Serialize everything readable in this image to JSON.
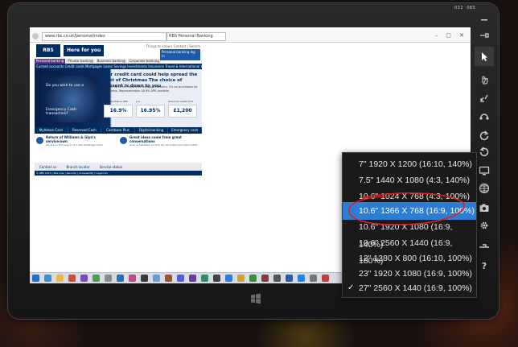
{
  "clock": {
    "left": "032",
    "right": "085"
  },
  "browser": {
    "address": "www.rbs.co.uk/personal/index",
    "tab_title": "RBS Personal Banking",
    "window_controls": "– ▢ ✕"
  },
  "rbs": {
    "logo": "RBS",
    "tagline": "Here for you",
    "top_links": "Things to know | Contact | Search",
    "login": "Personal banking log in",
    "tabs": [
      "Personal banking",
      "Private banking",
      "Business banking",
      "Corporate banking"
    ],
    "subnav": "Current accounts  Credit cards  Mortgages  Loans  Savings  Investments  Insurance  Travel & International  Ways to bank & More",
    "hero_photo_lines": [
      "Do you wish to use a",
      "Emergency Cash transaction?"
    ],
    "headline": "Our credit card could help spread the cost of Christmas The choice of present is down to you",
    "body": "0% for up to 16 months on balance transfers, 0% on purchases for 3 months. Representative 16.9% APR variable.",
    "rates": [
      {
        "value": "16.9%",
        "label": "Representative APR"
      },
      {
        "value": "16.95%",
        "label": "p.a."
      },
      {
        "value": "£1,200",
        "label": "Assumed credit limit"
      }
    ],
    "features": [
      "MyAdvan Card",
      "Reserved Cash",
      "Cashback Plus",
      "Digital banking",
      "Emergency cash"
    ],
    "info": [
      {
        "title": "Return of Williams & Glyn's service/own",
        "text": "We are on the launch of a new challenger bank"
      },
      {
        "title": "Great ideas come from great conversations",
        "text": "Give us feedback on how we can make your bank better"
      }
    ],
    "contact": [
      "Contact us",
      "Branch locator",
      "Service status"
    ],
    "footer": "© RBS 2013  |  Site map  |  Security  |  Accessibility  |  Legal info"
  },
  "toolbar": {
    "items": [
      "pin-icon",
      "pointer-icon",
      "touch-icon",
      "pinch-icon",
      "rotate-touch-icon",
      "rotate-clockwise-icon",
      "rotate-counter-icon",
      "resolution-icon",
      "network-icon",
      "camera-icon",
      "settings-icon",
      "dock-icon",
      "help-icon"
    ]
  },
  "menu": {
    "items": [
      {
        "label": "7\" 1920 X 1200 (16:10, 140%)",
        "selected": false,
        "checked": false
      },
      {
        "label": "7.5\" 1440 X 1080 (4:3, 140%)",
        "selected": false,
        "checked": false
      },
      {
        "label": "10.6\" 1024 X 768 (4:3, 100%)",
        "selected": false,
        "checked": false
      },
      {
        "label": "10.6\" 1366 X 768 (16:9, 100%)",
        "selected": true,
        "checked": false
      },
      {
        "label": "10.6\" 1920 X 1080 (16:9, 140%)",
        "selected": false,
        "checked": false
      },
      {
        "label": "10.6\" 2560 X 1440 (16:9, 180%)",
        "selected": false,
        "checked": false
      },
      {
        "label": "12\" 1280 X 800 (16:10, 100%)",
        "selected": false,
        "checked": false
      },
      {
        "label": "23\" 1920 X 1080 (16:9, 100%)",
        "selected": false,
        "checked": false
      },
      {
        "label": "27\" 2560 X 1440 (16:9, 100%)",
        "selected": false,
        "checked": true
      }
    ],
    "check_glyph": "✓"
  },
  "colors": {
    "menu_highlight": "#2a7fd4",
    "annotation": "#e02020",
    "rbs_navy": "#002d62"
  }
}
